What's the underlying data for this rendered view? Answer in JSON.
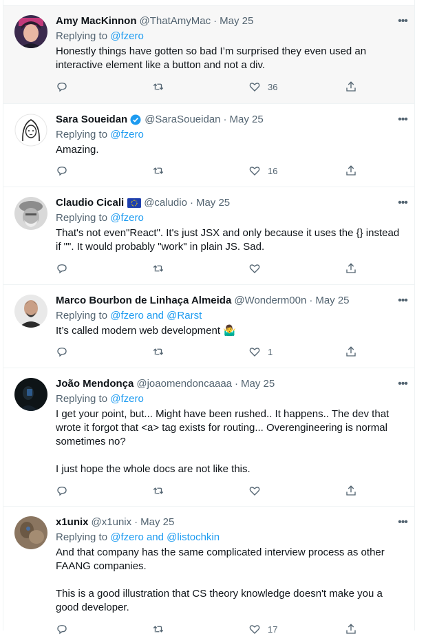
{
  "tweets": [
    {
      "name": "Amy MacKinnon",
      "handle": "@ThatAmyMac",
      "date": "May 25",
      "replying_prefix": "Replying to ",
      "mention1": "@fzero",
      "mention_join": "",
      "mention2": "",
      "text": "Honestly things have gotten so bad I’m surprised they even used an interactive element like a button and not a div.",
      "likes": "36"
    },
    {
      "name": "Sara Soueidan",
      "handle": "@SaraSoueidan",
      "date": "May 25",
      "replying_prefix": "Replying to ",
      "mention1": "@fzero",
      "mention_join": "",
      "mention2": "",
      "text": "Amazing.",
      "likes": "16"
    },
    {
      "name": "Claudio Cicali",
      "handle": "@caludio",
      "date": "May 25",
      "replying_prefix": "Replying to ",
      "mention1": "@fzero",
      "mention_join": "",
      "mention2": "",
      "text": "That's not even\"React\". It's just JSX and only because it uses the {} instead if \"\". It would probably \"work\" in plain JS. Sad.",
      "likes": ""
    },
    {
      "name": "Marco Bourbon de Linhaça Almeida",
      "handle": "@Wonderm00n",
      "date": "May 25",
      "replying_prefix": "Replying to ",
      "mention1": "@fzero",
      "mention_join": " and ",
      "mention2": "@Rarst",
      "text": "It’s called modern web development 🤷‍♂️",
      "likes": "1"
    },
    {
      "name": "João Mendonça",
      "handle": "@joaomendoncaaaa",
      "date": "May 25",
      "replying_prefix": "Replying to ",
      "mention1": "@fzero",
      "mention_join": "",
      "mention2": "",
      "text": "I get your point, but... Might have been rushed.. It happens.. The dev that wrote it forgot that <a> tag exists for routing... Overengineering is normal sometimes no?\n\nI just hope the whole docs are not like this.",
      "likes": ""
    },
    {
      "name": "x1unix",
      "handle": "@x1unix",
      "date": "May 25",
      "replying_prefix": "Replying to ",
      "mention1": "@fzero",
      "mention_join": " and ",
      "mention2": "@listochkin",
      "text": "And that company has the same complicated interview process as other FAANG companies.\n\nThis is a good illustration that CS theory knowledge doesn't make you a good developer.",
      "likes": "17"
    }
  ],
  "more_glyph": "•••",
  "colors": {
    "link": "#1d9bf0",
    "secondary": "#536471",
    "text": "#0f1419",
    "verified": "#1d9bf0",
    "hover_bg": "#f7f7f7"
  },
  "icons": [
    "reply-icon",
    "retweet-icon",
    "like-icon",
    "share-icon",
    "more-icon",
    "verified-badge-icon",
    "eu-flag-icon"
  ]
}
